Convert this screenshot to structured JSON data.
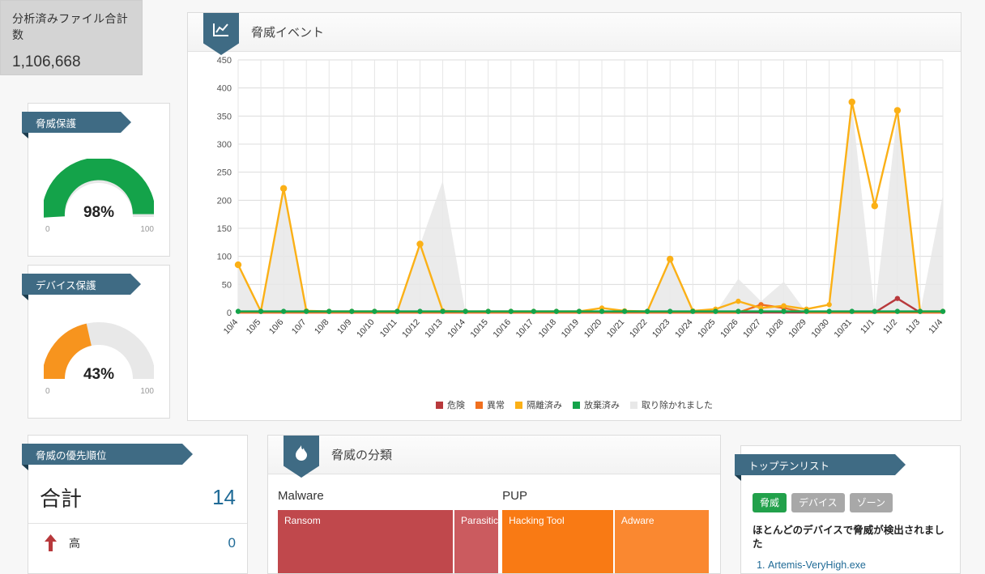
{
  "colors": {
    "accent": "#3f6b84",
    "danger": "#b8393c",
    "abnormal": "#f06f1e",
    "quarantined": "#fbb016",
    "abandoned": "#14a34a",
    "removed": "#e8e8e8",
    "link": "#1f6a96",
    "malware": "#c0484c",
    "malware_light": "#cb5b5f",
    "pup": "#f97a14",
    "pup_light": "#fa8830",
    "tab_active": "#22a14b",
    "tab_inactive": "#a8a8a8"
  },
  "total_files": {
    "label": "分析済みファイル合計数",
    "value": "1,106,668"
  },
  "gauges": [
    {
      "title": "脅威保護",
      "value": 98,
      "display": "98%",
      "min": "0",
      "max": "100",
      "color": "#14a34a",
      "track": "#e8e8e8"
    },
    {
      "title": "デバイス保護",
      "value": 43,
      "display": "43%",
      "min": "0",
      "max": "100",
      "color": "#f7941e",
      "track": "#e8e8e8"
    }
  ],
  "chart_panel": {
    "title": "脅威イベント",
    "icon": "line-chart-icon"
  },
  "chart_data": {
    "type": "line",
    "title": "脅威イベント",
    "xlabel": "",
    "ylabel": "",
    "ylim": [
      0,
      450
    ],
    "yticks": [
      0,
      50,
      100,
      150,
      200,
      250,
      300,
      350,
      400,
      450
    ],
    "grid": true,
    "legend_position": "bottom",
    "categories": [
      "10/4",
      "10/5",
      "10/6",
      "10/7",
      "10/8",
      "10/9",
      "10/10",
      "10/11",
      "10/12",
      "10/13",
      "10/14",
      "10/15",
      "10/16",
      "10/17",
      "10/18",
      "10/19",
      "10/20",
      "10/21",
      "10/22",
      "10/23",
      "10/24",
      "10/25",
      "10/26",
      "10/27",
      "10/28",
      "10/29",
      "10/30",
      "10/31",
      "11/1",
      "11/2",
      "11/3",
      "11/4"
    ],
    "series": [
      {
        "name": "危険",
        "color": "#b8393c",
        "values": [
          0,
          0,
          0,
          0,
          0,
          0,
          0,
          0,
          0,
          0,
          0,
          0,
          0,
          0,
          0,
          0,
          0,
          0,
          0,
          0,
          0,
          0,
          0,
          0,
          0,
          0,
          0,
          0,
          0,
          25,
          0,
          0
        ]
      },
      {
        "name": "異常",
        "color": "#f06f1e",
        "values": [
          0,
          0,
          0,
          0,
          0,
          0,
          0,
          0,
          0,
          0,
          0,
          0,
          0,
          0,
          0,
          0,
          0,
          0,
          0,
          0,
          0,
          0,
          0,
          14,
          8,
          0,
          0,
          0,
          0,
          0,
          0,
          0
        ]
      },
      {
        "name": "隔離済み",
        "color": "#fbb016",
        "values": [
          85,
          2,
          221,
          3,
          2,
          2,
          2,
          2,
          122,
          3,
          2,
          2,
          2,
          2,
          2,
          2,
          8,
          3,
          2,
          95,
          3,
          6,
          20,
          8,
          12,
          6,
          14,
          375,
          190,
          360,
          2,
          2
        ]
      },
      {
        "name": "放棄済み",
        "color": "#14a34a",
        "values": [
          2,
          2,
          2,
          2,
          2,
          2,
          2,
          2,
          2,
          2,
          2,
          2,
          2,
          2,
          2,
          2,
          2,
          2,
          2,
          2,
          2,
          2,
          2,
          2,
          2,
          2,
          2,
          2,
          2,
          2,
          2,
          2
        ]
      },
      {
        "name": "取り除かれました",
        "color": "#e8e8e8",
        "fill": true,
        "values": [
          80,
          0,
          215,
          0,
          0,
          0,
          0,
          0,
          120,
          235,
          0,
          0,
          0,
          0,
          0,
          0,
          0,
          0,
          0,
          95,
          0,
          0,
          60,
          20,
          55,
          0,
          0,
          370,
          0,
          355,
          0,
          210
        ]
      }
    ]
  },
  "priority_panel": {
    "title": "脅威の優先順位",
    "total_label": "合計",
    "total_value": "14",
    "rows": [
      {
        "icon": "arrow-up-icon",
        "label": "高",
        "value": "0",
        "color": "#b8393c",
        "direction": "up"
      }
    ]
  },
  "classification_panel": {
    "title": "脅威の分類",
    "icon": "flame-icon",
    "groups": [
      {
        "label": "Malware",
        "left_pct": 0,
        "width_pct": 51.3,
        "cells": [
          {
            "label": "Ransom",
            "width_pct": 79.6,
            "color": "#c0484c"
          },
          {
            "label": "Parasitic",
            "width_pct": 20.4,
            "color": "#cb5b5f"
          }
        ]
      },
      {
        "label": "PUP",
        "left_pct": 51.9,
        "width_pct": 48.1,
        "cells": [
          {
            "label": "Hacking Tool",
            "width_pct": 54.0,
            "color": "#f97a14"
          },
          {
            "label": "Adware",
            "width_pct": 46.0,
            "color": "#fa8830"
          }
        ]
      }
    ]
  },
  "top_ten_panel": {
    "title": "トップテンリスト",
    "tabs": [
      {
        "label": "脅威",
        "active": true
      },
      {
        "label": "デバイス",
        "active": false
      },
      {
        "label": "ゾーン",
        "active": false
      }
    ],
    "subtitle": "ほとんどのデバイスで脅威が検出されました",
    "items": [
      {
        "rank": "1.",
        "name": "Artemis-VeryHigh.exe"
      }
    ]
  }
}
